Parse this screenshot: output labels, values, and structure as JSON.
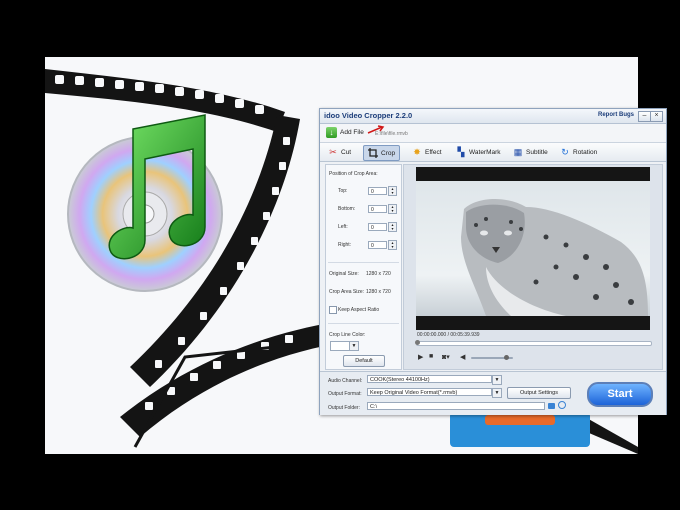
{
  "window": {
    "title": "idoo Video Cropper 2.2.0",
    "report_bugs": "Report Bugs",
    "minimize": "–",
    "close": "×"
  },
  "toolbar": {
    "add_file_label": "Add File",
    "file_path": "E:\\file\\file.rmvb"
  },
  "tabs": [
    {
      "label": "Cut",
      "icon": "scissors-icon"
    },
    {
      "label": "Crop",
      "icon": "crop-icon"
    },
    {
      "label": "Effect",
      "icon": "effect-icon"
    },
    {
      "label": "WaterMark",
      "icon": "watermark-icon"
    },
    {
      "label": "Subtitle",
      "icon": "subtitle-icon"
    },
    {
      "label": "Rotation",
      "icon": "rotation-icon"
    }
  ],
  "crop_panel": {
    "section_title": "Position of Crop Area:",
    "top_label": "Top:",
    "top_value": "0",
    "bottom_label": "Bottom:",
    "bottom_value": "0",
    "left_label": "Left:",
    "left_value": "0",
    "right_label": "Right:",
    "right_value": "0",
    "original_size_label": "Original Size:",
    "original_size_value": "1280 x 720",
    "crop_area_size_label": "Crop Area Size:",
    "crop_area_size_value": "1280 x 720",
    "keep_aspect_label": "Keep Aspect Ratio",
    "crop_line_color_label": "Crop Line Color:",
    "default_button": "Default"
  },
  "player": {
    "time": "00:00:00.000 / 00:05:39.939",
    "volume_level": 0.85
  },
  "output": {
    "audio_channel_label": "Audio Channel:",
    "audio_channel_value": "COOK(Stereo 44100Hz)",
    "output_format_label": "Output Format:",
    "output_format_value": "Keep Original Video Format(*.rmvb)",
    "output_settings_button": "Output Settings",
    "output_folder_label": "Output Folder:",
    "output_folder_value": "C:\\",
    "start_button": "Start"
  },
  "colors": {
    "title_text": "#1c3d7a",
    "start_button": "#1d63d8",
    "window_bg": "#eef1f5"
  }
}
